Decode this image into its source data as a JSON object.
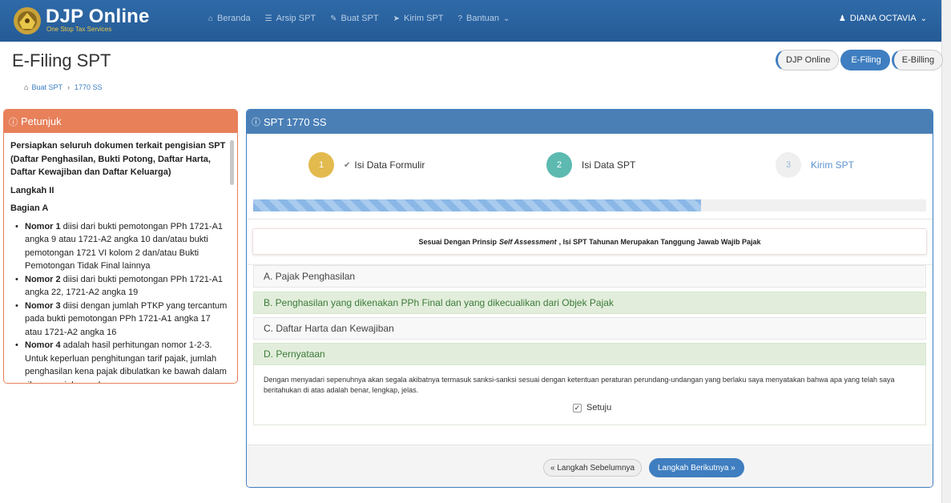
{
  "navbar": {
    "brand_title": "DJP Online",
    "brand_subtitle": "One Stop Tax Services",
    "menu": [
      {
        "label": "Beranda",
        "icon": "home-icon"
      },
      {
        "label": "Arsip SPT",
        "icon": "list-icon"
      },
      {
        "label": "Buat SPT",
        "icon": "edit-icon"
      },
      {
        "label": "Kirim SPT",
        "icon": "send-icon"
      },
      {
        "label": "Bantuan",
        "icon": "help-icon"
      }
    ],
    "user": "DIANA OCTAVIA"
  },
  "header": {
    "title": "E-Filing SPT",
    "breadcrumb": [
      "Buat SPT",
      "1770 SS"
    ],
    "pills": [
      "DJP Online",
      "E-Filing",
      "E-Billing"
    ],
    "active_pill": "E-Filing"
  },
  "petunjuk": {
    "title": "Petunjuk",
    "intro": "Persiapkan seluruh dokumen terkait pengisian SPT (Daftar Penghasilan, Bukti Potong, Daftar Harta, Daftar Kewajiban dan Daftar Keluarga)",
    "step": "Langkah II",
    "section": "Bagian A",
    "items": [
      {
        "bold": "Nomor 1",
        "text": " diisi dari bukti pemotongan PPh 1721-A1 angka 9 atau 1721-A2 angka 10 dan/atau bukti pemotongan 1721 VI kolom 2 dan/atau Bukti Pemotongan Tidak Final lainnya"
      },
      {
        "bold": "Nomor 2",
        "text": " diisi dari bukti pemotongan PPh 1721-A1 angka 22, 1721-A2 angka 19"
      },
      {
        "bold": "Nomor 3",
        "text": " diisi dengan jumlah PTKP yang tercantum pada bukti pemotongan PPh 1721-A1 angka 17 atau 1721-A2 angka 16"
      },
      {
        "bold": "Nomor 4",
        "text": " adalah hasil perhitungan nomor 1-2-3. Untuk keperluan penghitungan tarif pajak, jumlah penghasilan kena pajak dibulatkan ke bawah dalam ribuan rupiah penuh"
      }
    ]
  },
  "main": {
    "title": "SPT 1770 SS",
    "steps": [
      {
        "num": "1",
        "label": "Isi Data Formulir"
      },
      {
        "num": "2",
        "label": "Isi Data SPT"
      },
      {
        "num": "3",
        "label": "Kirim SPT"
      }
    ],
    "progress_fraction": 0.665,
    "notice_pre": "Sesuai Dengan Prinsip",
    "notice_em": "Self Assessment",
    "notice_post": ", Isi SPT Tahunan Merupakan Tanggung Jawab Wajib Pajak",
    "sections": [
      "A. Pajak Penghasilan",
      "B. Penghasilan yang dikenakan PPh Final dan yang dikecualikan dari Objek Pajak",
      "C. Daftar Harta dan Kewajiban",
      "D. Pernyataan"
    ],
    "statement": "Dengan menyadari sepenuhnya akan segala akibatnya termasuk sanksi-sanksi sesuai dengan ketentuan peraturan perundang-undangan yang berlaku saya menyatakan bahwa apa yang telah saya beritahukan di atas adalah benar, lengkap, jelas.",
    "agree_label": "Setuju",
    "agree_checked": true,
    "btn_prev": "« Langkah Sebelumnya",
    "btn_next": "Langkah Berikutnya »"
  }
}
